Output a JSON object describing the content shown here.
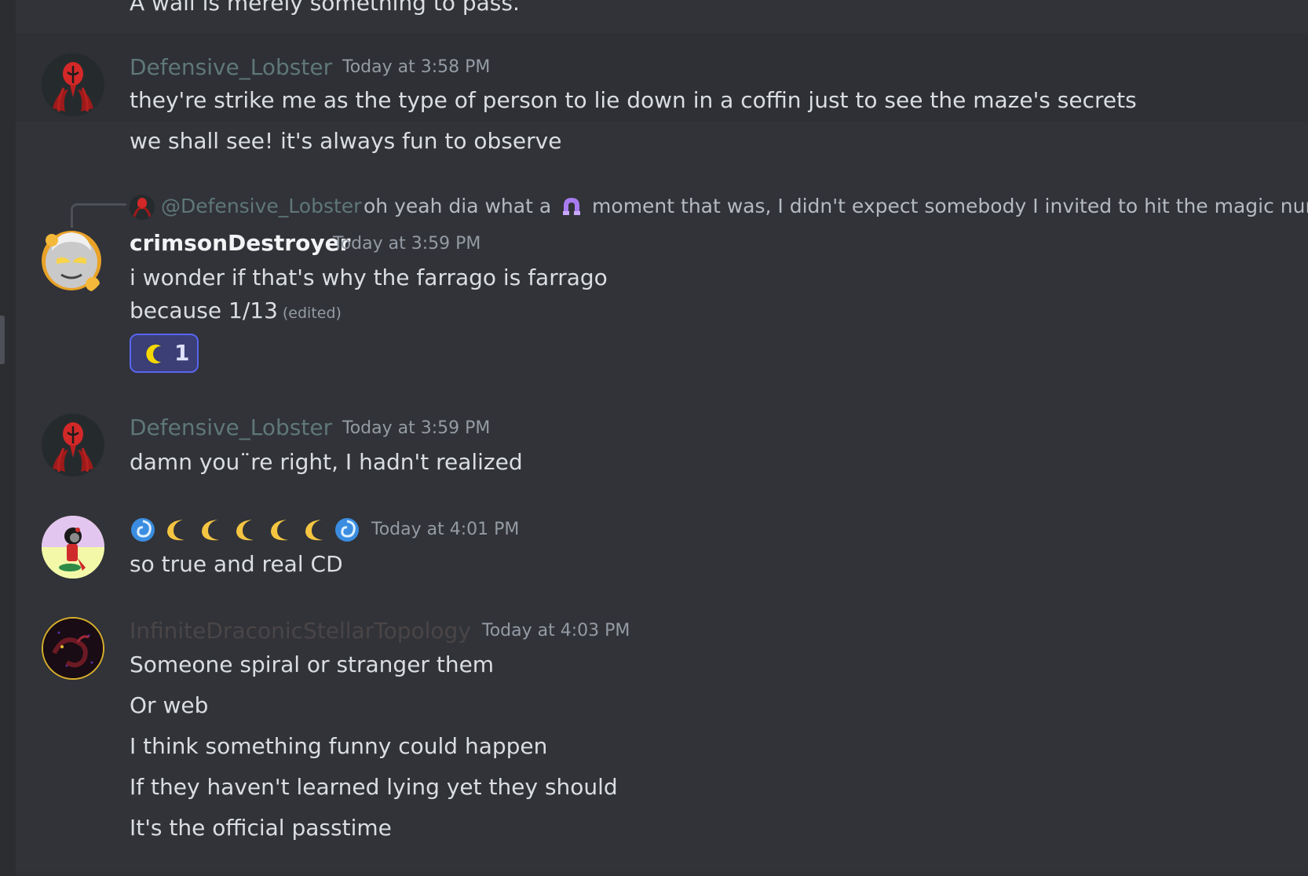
{
  "colors": {
    "background": "#313338",
    "text": "#dbdee1",
    "timestamp": "#949ba4",
    "defensive_lobster": "#5f7777",
    "crimson_destroyer": "#f2f3f5",
    "infinite_draconic": "#4a4547",
    "reaction_accent": "#5865f2"
  },
  "messages": [
    {
      "partial_text": "A wall is merely something to pass."
    },
    {
      "author": "Defensive_Lobster",
      "avatar": "red-lobster-avatar",
      "timestamp": "Today at 3:58 PM",
      "lines": [
        "they're strike me as the type of person to lie down in a coffin just to see the maze's secrets",
        "we shall see! it's always fun to observe"
      ]
    },
    {
      "reply": {
        "mention": "@Defensive_Lobster",
        "text_before": "oh yeah dia what a",
        "emoji": "purple-horseshoe-emoji",
        "text_after": "moment that was, I didn't expect somebody I invited to hit the magic number"
      },
      "author": "crimsonDestroyer",
      "avatar": "gray-troll-avatar",
      "timestamp": "Today at 3:59 PM",
      "lines": [
        "i wonder if that's why the farrago is farrago",
        "because 1/13"
      ],
      "edited_label": "(edited)",
      "reaction": {
        "emoji": "crescent-moon-emoji",
        "count": "1"
      }
    },
    {
      "author": "Defensive_Lobster",
      "avatar": "red-lobster-avatar",
      "timestamp": "Today at 3:59 PM",
      "lines": [
        "damn you¨re right, I hadn't realized"
      ]
    },
    {
      "author_emoji": [
        "cyclone",
        "crescent-moon",
        "crescent-moon",
        "crescent-moon",
        "crescent-moon",
        "crescent-moon",
        "cyclone"
      ],
      "avatar": "sitting-girl-avatar",
      "timestamp": "Today at 4:01 PM",
      "lines": [
        "so true and real CD"
      ]
    },
    {
      "author": "InfiniteDraconicStellarTopology",
      "avatar": "dark-dragon-avatar",
      "timestamp": "Today at 4:03 PM",
      "lines": [
        "Someone spiral or stranger them",
        "Or web",
        "I think something funny could happen",
        "If they haven't learned lying yet they should",
        "It's the official passtime"
      ]
    }
  ]
}
